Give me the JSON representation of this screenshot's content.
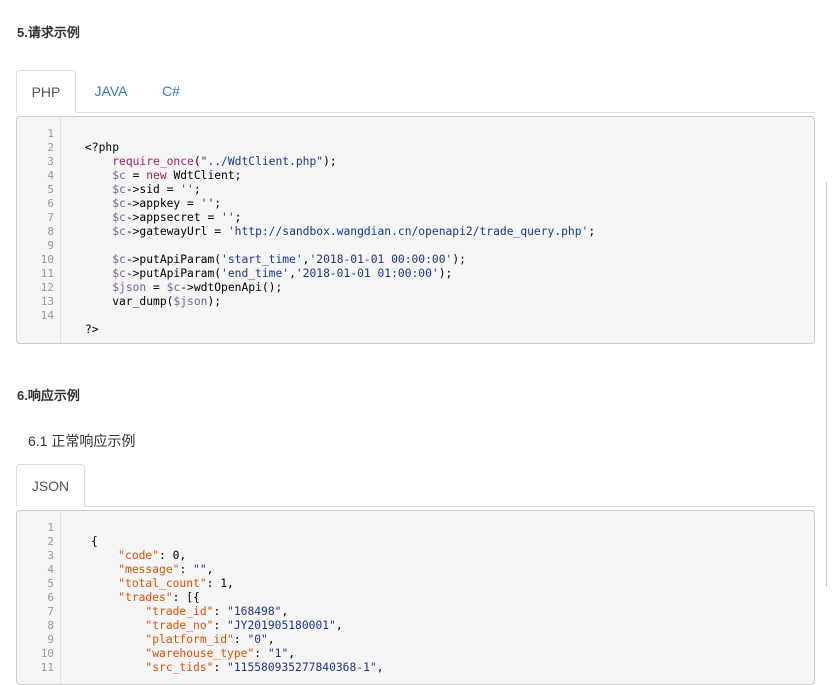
{
  "request_section": {
    "title": "5.请求示例",
    "tabs": [
      "PHP",
      "JAVA",
      "C#"
    ],
    "active_tab": "PHP",
    "line_numbers": [
      "1",
      "2",
      "3",
      "4",
      "5",
      "6",
      "7",
      "8",
      "9",
      "10",
      "11",
      "12",
      "13",
      "14"
    ],
    "lines": [
      "",
      "<?php",
      "    require_once(\"../WdtClient.php\");",
      "    $c = new WdtClient;",
      "    $c->sid = '';",
      "    $c->appkey = '';",
      "    $c->appsecret = '';",
      "    $c->gatewayUrl = 'http://sandbox.wangdian.cn/openapi2/trade_query.php';",
      "",
      "    $c->putApiParam('start_time','2018-01-01 00:00:00');",
      "    $c->putApiParam('end_time','2018-01-01 01:00:00');",
      "    $json = $c->wdtOpenApi();",
      "    var_dump($json);",
      "",
      "?>"
    ]
  },
  "response_section": {
    "title": "6.响应示例",
    "subtitle": "6.1 正常响应示例",
    "tabs": [
      "JSON"
    ],
    "active_tab": "JSON",
    "line_numbers": [
      "1",
      "2",
      "3",
      "4",
      "5",
      "6",
      "7",
      "8",
      "9",
      "10",
      "11"
    ],
    "lines": [
      "",
      "{",
      "    \"code\": 0,",
      "    \"message\": \"\",",
      "    \"total_count\": 1,",
      "    \"trades\": [{",
      "        \"trade_id\": \"168498\",",
      "        \"trade_no\": \"JY201905180001\",",
      "        \"platform_id\": \"0\",",
      "        \"warehouse_type\": \"1\",",
      "        \"src_tids\": \"115580935277840368-1\","
    ]
  }
}
